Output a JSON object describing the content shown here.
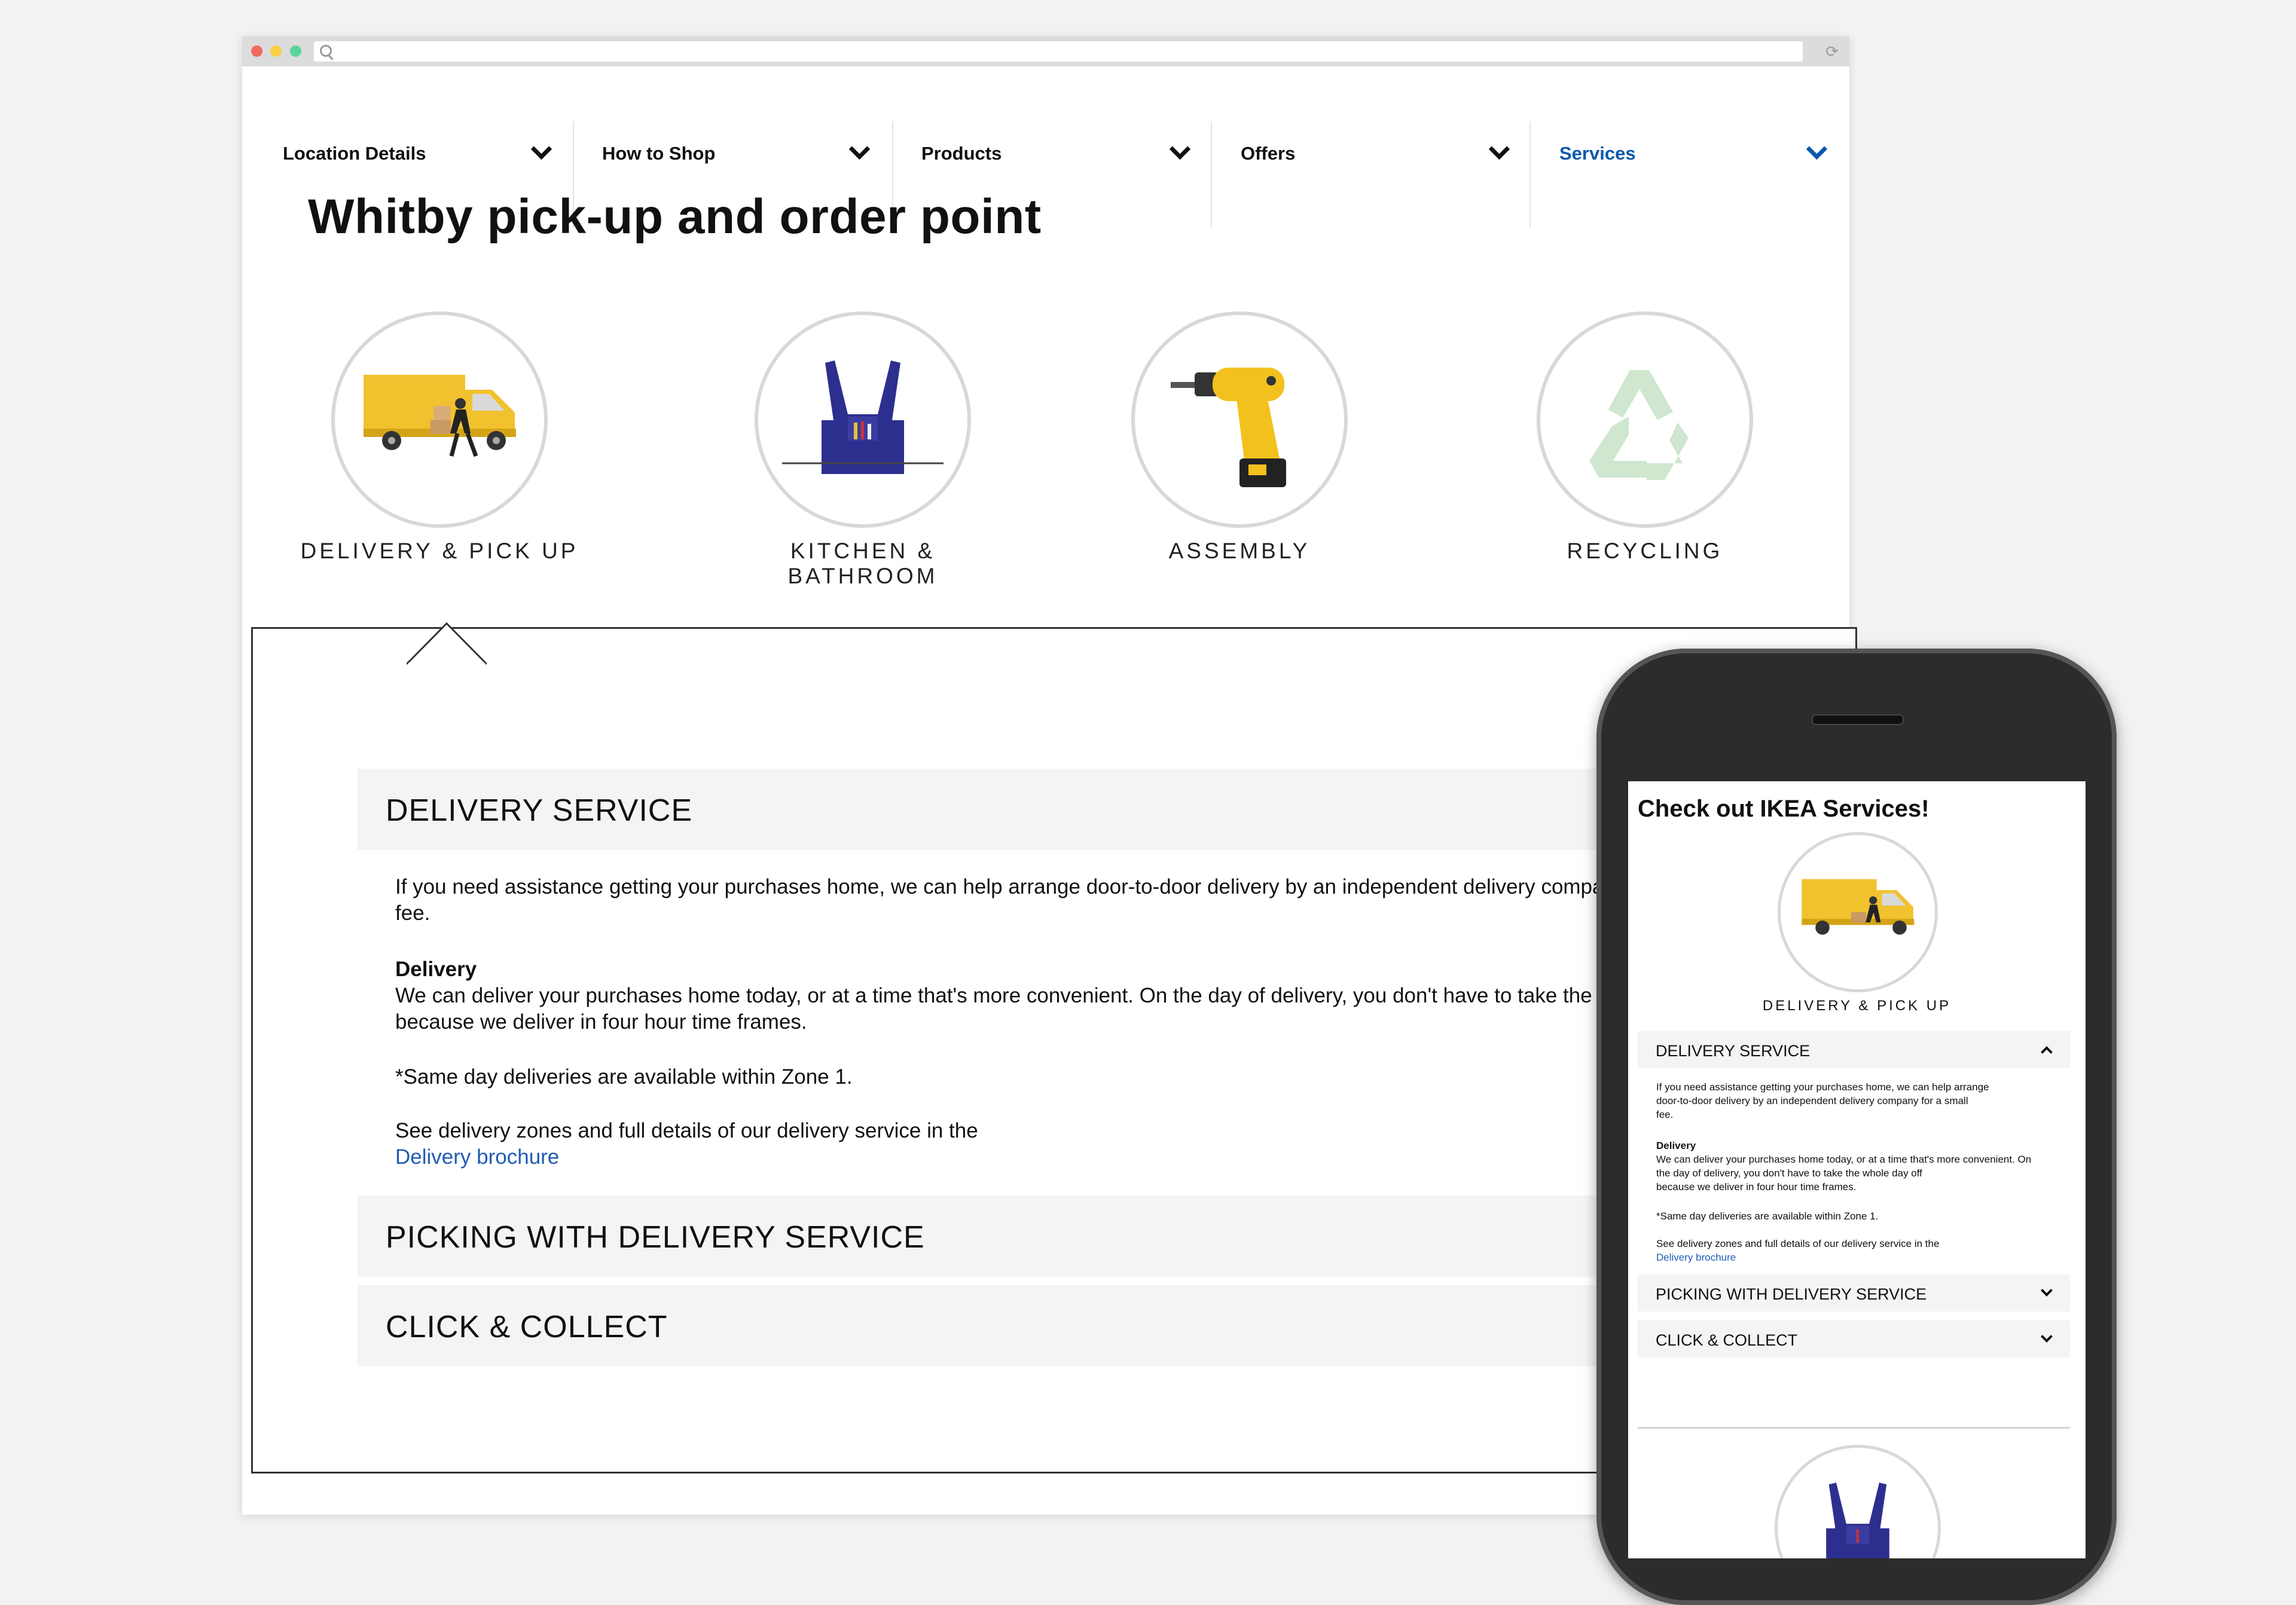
{
  "nav": {
    "items": [
      {
        "label": "Location Details"
      },
      {
        "label": "How to Shop"
      },
      {
        "label": "Products"
      },
      {
        "label": "Offers"
      },
      {
        "label": "Services"
      }
    ]
  },
  "page": {
    "title": "Whitby pick-up and order point"
  },
  "services": [
    {
      "label": "DELIVERY & PICK UP"
    },
    {
      "label": "KITCHEN & BATHROOM"
    },
    {
      "label": "ASSEMBLY"
    },
    {
      "label": "RECYCLING"
    }
  ],
  "accordion": {
    "delivery_service": "DELIVERY SERVICE",
    "picking": "PICKING WITH DELIVERY SERVICE",
    "click_collect": "CLICK & COLLECT"
  },
  "delivery": {
    "intro_line1": "If you need assistance getting your purchases home, we can help arrange door-to-door delivery by an independent delivery compa",
    "intro_line2": "fee.",
    "heading": "Delivery",
    "para_line1": "We can deliver your purchases home today, or at a time that's more convenient. On the day of delivery, you don't have to take the",
    "para_line2": "because we deliver in four hour time frames.",
    "same_day": "*Same day deliveries are available within Zone 1.",
    "zones": "See delivery zones and full details of our delivery service in the",
    "brochure_link": "Delivery brochure"
  },
  "mobile": {
    "title": "Check out IKEA Services!",
    "service_label": "DELIVERY & PICK UP",
    "acc_delivery": "DELIVERY SERVICE",
    "acc_picking": "PICKING WITH DELIVERY SERVICE",
    "acc_click": "CLICK & COLLECT",
    "text_intro1": "If you need assistance getting your purchases home, we can help arrange",
    "text_intro2": "door-to-door delivery by an independent delivery company for a small",
    "text_intro3": "fee.",
    "text_heading": "Delivery",
    "text_para1": "We can deliver your purchases home today, or at a time that's more convenient. On",
    "text_para2": "the day of delivery, you don't have to take the whole day off",
    "text_para3": "because we deliver in four hour time frames.",
    "text_same_day": "*Same day deliveries are available within Zone 1.",
    "text_zones": "See delivery zones and full details of our delivery service in the",
    "text_link": "Delivery brochure"
  },
  "colors": {
    "accent_blue": "#0a5aab",
    "link_blue": "#1f5bb5",
    "truck_yellow": "#f2c12e",
    "recycle_green": "#cfe6cf"
  }
}
